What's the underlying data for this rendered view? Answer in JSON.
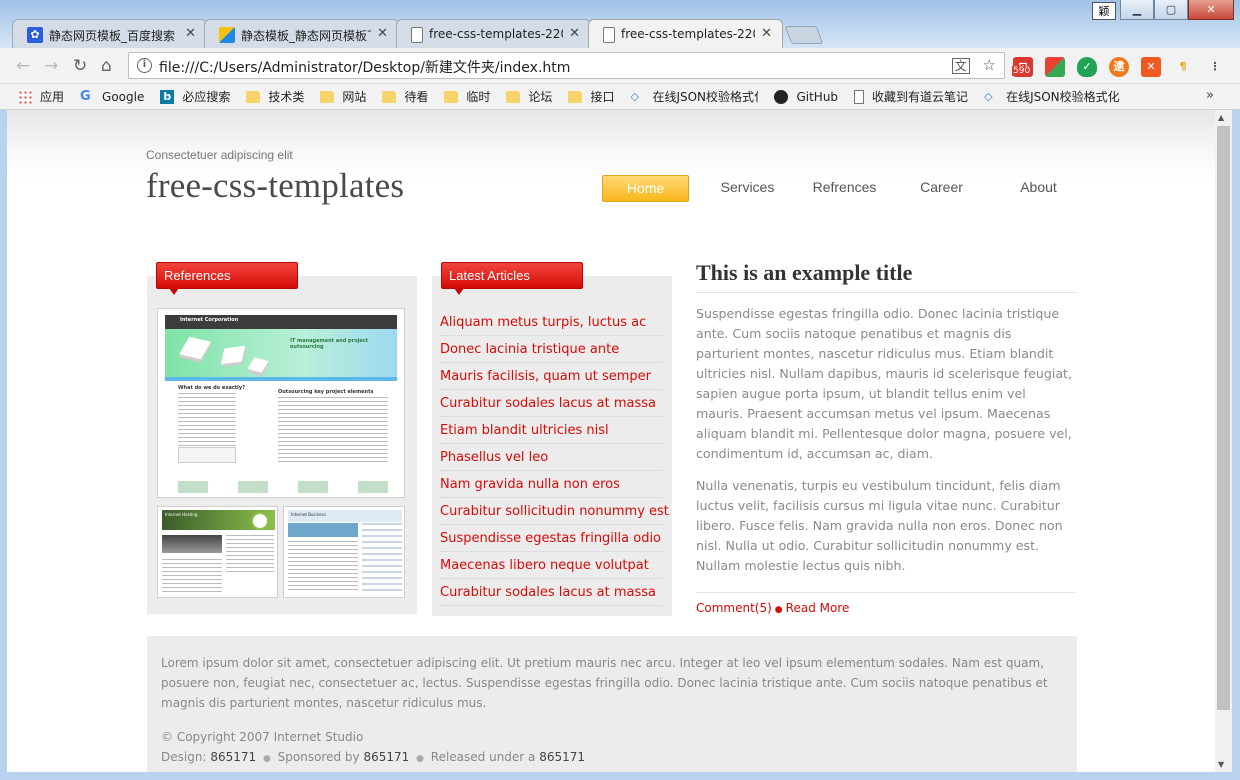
{
  "window": {
    "ime_label": "颖",
    "tabs": [
      {
        "title": "静态网页模板_百度搜索",
        "active": false,
        "favicon": "baidu-paw"
      },
      {
        "title": "静态模板_静态网页模板下",
        "active": false,
        "favicon": "colorful-square"
      },
      {
        "title": "free-css-templates-220",
        "active": false,
        "favicon": "page"
      },
      {
        "title": "free-css-templates-220",
        "active": true,
        "favicon": "page"
      }
    ]
  },
  "toolbar": {
    "url": "file:///C:/Users/Administrator/Desktop/新建文件夹/index.htm",
    "ext_badge": "590"
  },
  "bookmarks": [
    {
      "label": "应用",
      "icon": "apps-grid"
    },
    {
      "label": "Google",
      "icon": "google-g"
    },
    {
      "label": "必应搜索",
      "icon": "bing-b"
    },
    {
      "label": "技术类",
      "icon": "folder"
    },
    {
      "label": "网站",
      "icon": "folder"
    },
    {
      "label": "待看",
      "icon": "folder"
    },
    {
      "label": "临时",
      "icon": "folder"
    },
    {
      "label": "论坛",
      "icon": "folder"
    },
    {
      "label": "接口",
      "icon": "folder"
    },
    {
      "label": "在线JSON校验格式化",
      "icon": "code-diamond"
    },
    {
      "label": "GitHub",
      "icon": "github"
    },
    {
      "label": "收藏到有道云笔记",
      "icon": "page"
    },
    {
      "label": "在线JSON校验格式化",
      "icon": "code-diamond"
    }
  ],
  "site": {
    "tagline": "Consectetuer adipiscing elit",
    "logo": "free-css-templates",
    "menu": [
      "Home",
      "Services",
      "Refrences",
      "Career",
      "About"
    ],
    "active_menu": "Home"
  },
  "references": {
    "heading": "References",
    "thumb_main_brand": "Internet Corporation",
    "thumb_main_banner": "IT management and project outsourcing",
    "thumb_main_q": "What do we do exactly?",
    "thumb_main_h": "Outsourcing key project elements",
    "thumb_b_brand": "Internet Hosting",
    "thumb_c_brand": "Internet Business"
  },
  "articles": {
    "heading": "Latest Articles",
    "items": [
      "Aliquam metus turpis, luctus ac",
      "Donec lacinia tristique ante",
      "Mauris facilisis, quam ut semper",
      "Curabitur sodales lacus at massa",
      "Etiam blandit ultricies nisl",
      "Phasellus vel leo",
      "Nam gravida nulla non eros",
      "Curabitur sollicitudin nonummy est",
      "Suspendisse egestas fringilla odio",
      "Maecenas libero neque volutpat",
      "Curabitur sodales lacus at massa"
    ]
  },
  "post": {
    "title": "This is an example title",
    "para1": "Suspendisse egestas fringilla odio. Donec lacinia tristique ante. Cum sociis natoque penatibus et magnis dis parturient montes, nascetur ridiculus mus. Etiam blandit ultricies nisl. Nullam dapibus, mauris id scelerisque feugiat, sapien augue porta ipsum, ut blandit tellus enim vel mauris. Praesent accumsan metus vel ipsum. Maecenas aliquam blandit mi. Pellentesque dolor magna, posuere vel, condimentum id, accumsan ac, diam.",
    "para2": "Nulla venenatis, turpis eu vestibulum tincidunt, felis diam luctus velit, facilisis cursus mi ligula vitae nunc. Curabitur libero. Fusce felis. Nam gravida nulla non eros. Donec non nisl. Nulla ut odio. Curabitur sollicitudin nonummy est. Nullam molestie lectus quis nibh.",
    "comments": "Comment(5)",
    "read_more": "Read More"
  },
  "footer": {
    "text": "Lorem ipsum dolor sit amet, consectetuer adipiscing elit. Ut pretium mauris nec arcu. Integer at leo vel ipsum elementum sodales. Nam est quam, posuere non, feugiat nec, consectetuer ac, lectus. Suspendisse egestas fringilla odio. Donec lacinia tristique ante. Cum sociis natoque penatibus et magnis dis parturient montes, nascetur ridiculus mus.",
    "copyright": "© Copyright 2007 Internet Studio",
    "design_label": "Design:",
    "design_value": "865171",
    "sponsored_label": "Sponsored by",
    "sponsored_value": "865171",
    "released_label": "Released under a",
    "released_value": "865171"
  },
  "colors": {
    "accent_red": "#d80a06",
    "menu_active": "#f8b71c",
    "panel_bg": "#ececec"
  }
}
